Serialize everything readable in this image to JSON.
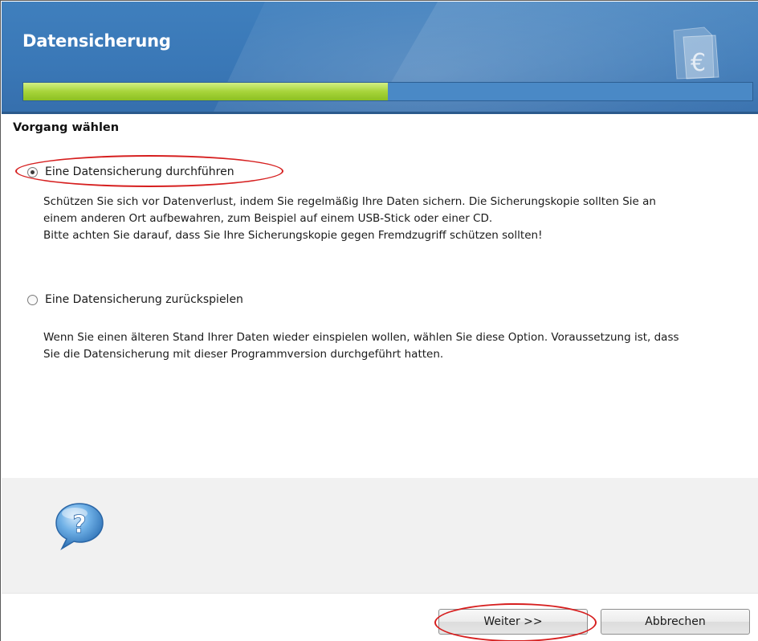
{
  "header": {
    "title": "Datensicherung",
    "progress_fraction": 0.5,
    "logo_glyph": "€"
  },
  "section": {
    "title": "Vorgang wählen"
  },
  "options": [
    {
      "label": "Eine Datensicherung durchführen",
      "checked": true,
      "description": [
        "Schützen Sie sich vor Datenverlust, indem Sie regelmäßig Ihre Daten sichern. Die Sicherungskopie sollten Sie an",
        "einem anderen Ort aufbewahren, zum Beispiel auf einem USB-Stick oder einer CD.",
        "Bitte achten Sie darauf, dass Sie Ihre Sicherungskopie gegen Fremdzugriff schützen sollten!"
      ]
    },
    {
      "label": "Eine Datensicherung zurückspielen",
      "checked": false,
      "description": [
        "Wenn Sie einen älteren Stand Ihrer Daten wieder einspielen wollen, wählen Sie diese Option. Voraussetzung ist, dass",
        "Sie die Datensicherung mit dieser Programmversion durchgeführt hatten."
      ]
    }
  ],
  "help": {
    "icon": "question-speech-bubble-icon",
    "glyph": "?"
  },
  "footer": {
    "next_label": "Weiter >>",
    "cancel_label": "Abbrechen"
  },
  "colors": {
    "header_blue": "#3b7aba",
    "progress_green": "#a7d43a",
    "annotation_red": "#d61f1f"
  }
}
